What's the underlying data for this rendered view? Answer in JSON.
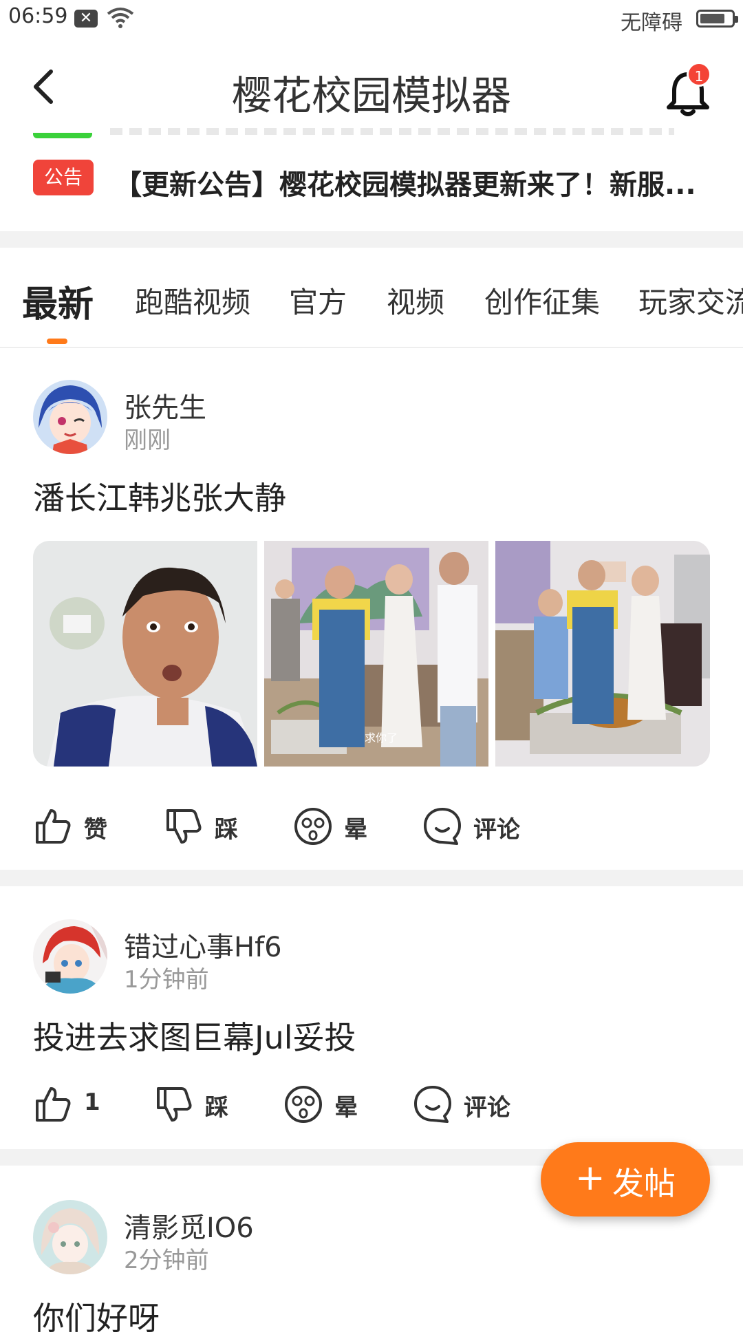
{
  "status": {
    "time": "06:59",
    "accessibility": "无障碍",
    "battery_level": 0.8
  },
  "header": {
    "title": "樱花校园模拟器",
    "notification_count": "1"
  },
  "announcement": {
    "tag": "公告",
    "text": "【更新公告】樱花校园模拟器更新来了！新服..."
  },
  "tabs": [
    {
      "label": "最新"
    },
    {
      "label": "跑酷视频"
    },
    {
      "label": "官方"
    },
    {
      "label": "视频"
    },
    {
      "label": "创作征集"
    },
    {
      "label": "玩家交流"
    }
  ],
  "posts": [
    {
      "username": "张先生",
      "time": "刚刚",
      "text": "潘长江韩兆张大静",
      "image_caption": "求你了",
      "actions": {
        "like": "赞",
        "dislike": "踩",
        "dizzy": "晕",
        "comment": "评论"
      }
    },
    {
      "username": "错过心事Hf6",
      "time": "1分钟前",
      "text": "投进去求图巨幕Jul妥投",
      "actions": {
        "like": "1",
        "dislike": "踩",
        "dizzy": "晕",
        "comment": "评论"
      }
    },
    {
      "username": "清影觅IO6",
      "time": "2分钟前",
      "text": "你们好呀"
    }
  ],
  "fab": {
    "label": "发帖",
    "icon": "plus-icon"
  },
  "colors": {
    "accent": "#ff7a1a",
    "announce_tag": "#f0443a",
    "badge": "#f44336"
  }
}
